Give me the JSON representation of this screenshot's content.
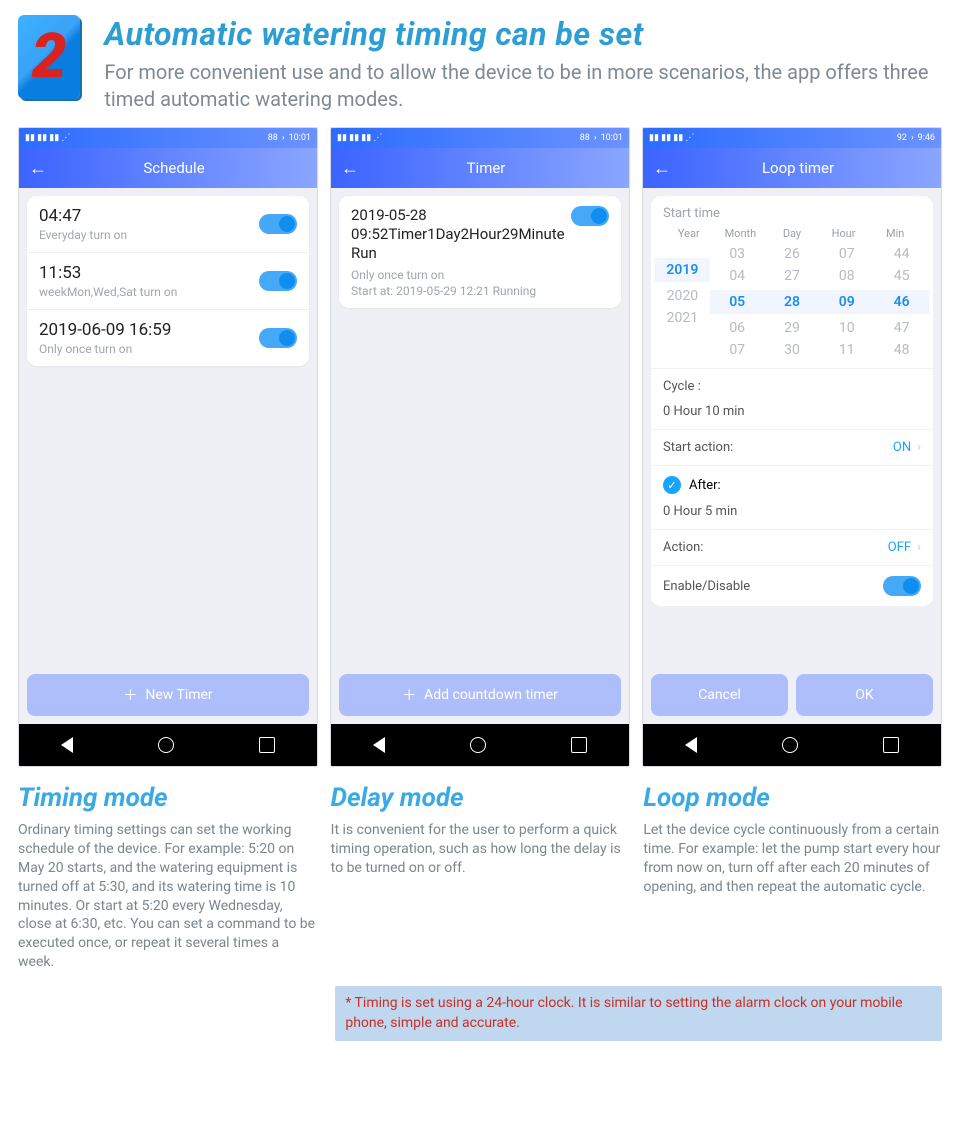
{
  "hero": {
    "step": "2",
    "title": "Automatic watering timing can be set",
    "subtitle": "For more convenient use and to allow the device to be in more scenarios, the app offers three timed automatic watering modes."
  },
  "statusbar": {
    "signal": "ᵃⁿᵗ ᵃⁿᵗ ᵃⁿᵗ",
    "battery1": "88",
    "time1": "10:01",
    "battery2": "88",
    "time2": "10:01",
    "battery3": "92",
    "time3": "9:46",
    "wifi": "⋮⋮ ⋰"
  },
  "phone1": {
    "title": "Schedule",
    "items": [
      {
        "primary": "04:47",
        "secondary": "Everyday turn on"
      },
      {
        "primary": "11:53",
        "secondary": "weekMon,Wed,Sat turn on"
      },
      {
        "primary": "2019-06-09 16:59",
        "secondary": "Only once turn on"
      }
    ],
    "button": "New Timer"
  },
  "phone2": {
    "title": "Timer",
    "item": {
      "primary": "2019-05-28 09:52Timer1Day2Hour29Minute Run",
      "secondary1": "Only once turn on",
      "secondary2": "Start at: 2019-05-29 12:21 Running"
    },
    "button": "Add countdown timer"
  },
  "phone3": {
    "title": "Loop timer",
    "start_time_label": "Start time",
    "headers": {
      "year": "Year",
      "month": "Month",
      "day": "Day",
      "hour": "Hour",
      "min": "Min"
    },
    "picker": {
      "year": [
        "",
        "",
        "2019",
        "2020",
        "2021"
      ],
      "month": [
        "03",
        "04",
        "05",
        "06",
        "07"
      ],
      "day": [
        "26",
        "27",
        "28",
        "29",
        "30"
      ],
      "hour": [
        "07",
        "08",
        "09",
        "10",
        "11"
      ],
      "min": [
        "44",
        "45",
        "46",
        "47",
        "48"
      ]
    },
    "cycle_label": "Cycle :",
    "cycle_value": "0  Hour  10 min",
    "start_action_label": "Start action:",
    "start_action_value": "ON",
    "after_label": "After:",
    "after_value": "0  Hour  5 min",
    "action_label": "Action:",
    "action_value": "OFF",
    "enable_label": "Enable/Disable",
    "cancel": "Cancel",
    "ok": "OK"
  },
  "captions": {
    "c1": {
      "title": "Timing mode",
      "body": "Ordinary timing settings can set the working schedule of the device.  For example: 5:20 on May 20 starts, and the watering equipment is turned off at 5:30, and its watering time is 10 minutes. Or start at 5:20 every Wednesday, close at 6:30, etc. You can set a command to be executed once, or repeat it several times a week."
    },
    "c2": {
      "title": "Delay mode",
      "body": "It is convenient for the user to perform a quick timing operation, such as how long the delay is to be turned on or off."
    },
    "c3": {
      "title": "Loop mode",
      "body": "Let the device cycle continuously from a certain time. For example: let the pump start every hour from now on, turn off after each 20 minutes of opening, and then repeat the automatic cycle."
    }
  },
  "note": "* Timing is set using a 24-hour clock. It is similar to setting the alarm clock on your mobile phone, simple and accurate."
}
